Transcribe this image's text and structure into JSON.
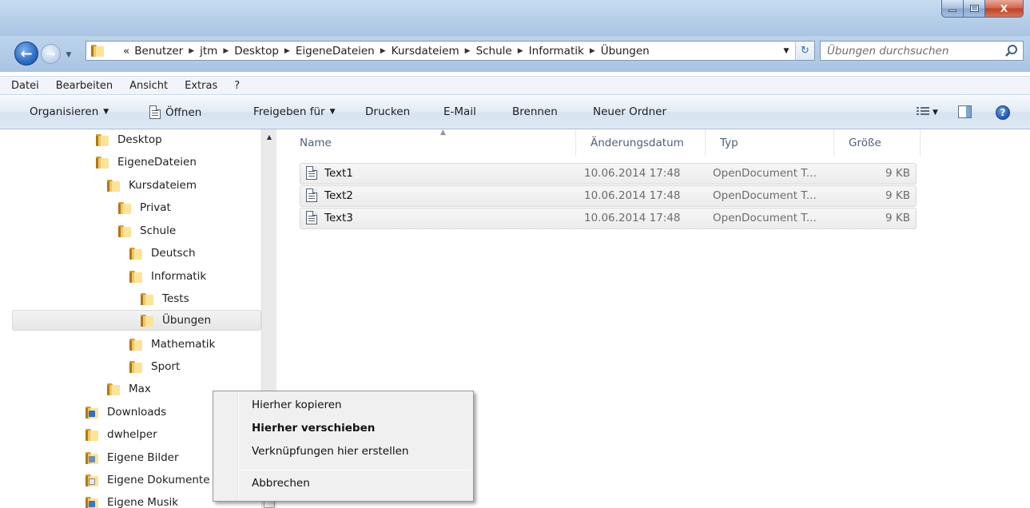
{
  "window": {
    "controls": {
      "minimize": "_",
      "maximize": "□",
      "close": "X"
    }
  },
  "nav": {
    "back_icon": "back-arrow-icon",
    "forward_icon": "forward-arrow-icon",
    "overflow": "«",
    "breadcrumb": [
      "Benutzer",
      "jtm",
      "Desktop",
      "EigeneDateien",
      "Kursdateiem",
      "Schule",
      "Informatik",
      "Übungen"
    ],
    "search_placeholder": "Übungen durchsuchen"
  },
  "menubar": [
    "Datei",
    "Bearbeiten",
    "Ansicht",
    "Extras",
    "?"
  ],
  "toolbar": {
    "organize": "Organisieren",
    "open": "Öffnen",
    "share": "Freigeben für",
    "print": "Drucken",
    "email": "E-Mail",
    "burn": "Brennen",
    "new_folder": "Neuer Ordner",
    "help": "?"
  },
  "tree": [
    {
      "label": "Desktop",
      "level": 0,
      "icon": "folder-icon"
    },
    {
      "label": "EigeneDateien",
      "level": 0,
      "icon": "folder-icon"
    },
    {
      "label": "Kursdateiem",
      "level": 1,
      "icon": "folder-icon"
    },
    {
      "label": "Privat",
      "level": 2,
      "icon": "folder-icon"
    },
    {
      "label": "Schule",
      "level": 2,
      "icon": "folder-icon"
    },
    {
      "label": "Deutsch",
      "level": 3,
      "icon": "folder-icon"
    },
    {
      "label": "Informatik",
      "level": 3,
      "icon": "folder-icon"
    },
    {
      "label": "Tests",
      "level": 4,
      "icon": "folder-icon"
    },
    {
      "label": "Übungen",
      "level": 4,
      "icon": "folder-icon",
      "selected": true
    },
    {
      "label": "Mathematik",
      "level": 3,
      "icon": "folder-icon"
    },
    {
      "label": "Sport",
      "level": 3,
      "icon": "folder-icon"
    },
    {
      "label": "Max",
      "level": 1,
      "icon": "folder-icon"
    },
    {
      "label": "Downloads",
      "level": -1,
      "icon": "downloads-folder-icon"
    },
    {
      "label": "dwhelper",
      "level": -1,
      "icon": "folder-icon"
    },
    {
      "label": "Eigene Bilder",
      "level": -1,
      "icon": "pictures-folder-icon"
    },
    {
      "label": "Eigene Dokumente",
      "level": -1,
      "icon": "documents-folder-icon"
    },
    {
      "label": "Eigene Musik",
      "level": -1,
      "icon": "music-folder-icon"
    }
  ],
  "files": {
    "columns": [
      "Name",
      "Änderungsdatum",
      "Typ",
      "Größe"
    ],
    "rows": [
      {
        "name": "Text1",
        "date": "10.06.2014 17:48",
        "type": "OpenDocument T...",
        "size": "9 KB"
      },
      {
        "name": "Text2",
        "date": "10.06.2014 17:48",
        "type": "OpenDocument T...",
        "size": "9 KB"
      },
      {
        "name": "Text3",
        "date": "10.06.2014 17:48",
        "type": "OpenDocument T...",
        "size": "9 KB"
      }
    ]
  },
  "context_menu": {
    "items": [
      "Hierher kopieren",
      "Hierher verschieben",
      "Verknüpfungen hier erstellen",
      "Abbrechen"
    ],
    "default_item": "Hierher verschieben"
  },
  "colors": {
    "frame": "#b4cde8",
    "accent": "#2c6bc4",
    "folder": "#f3c75f"
  }
}
